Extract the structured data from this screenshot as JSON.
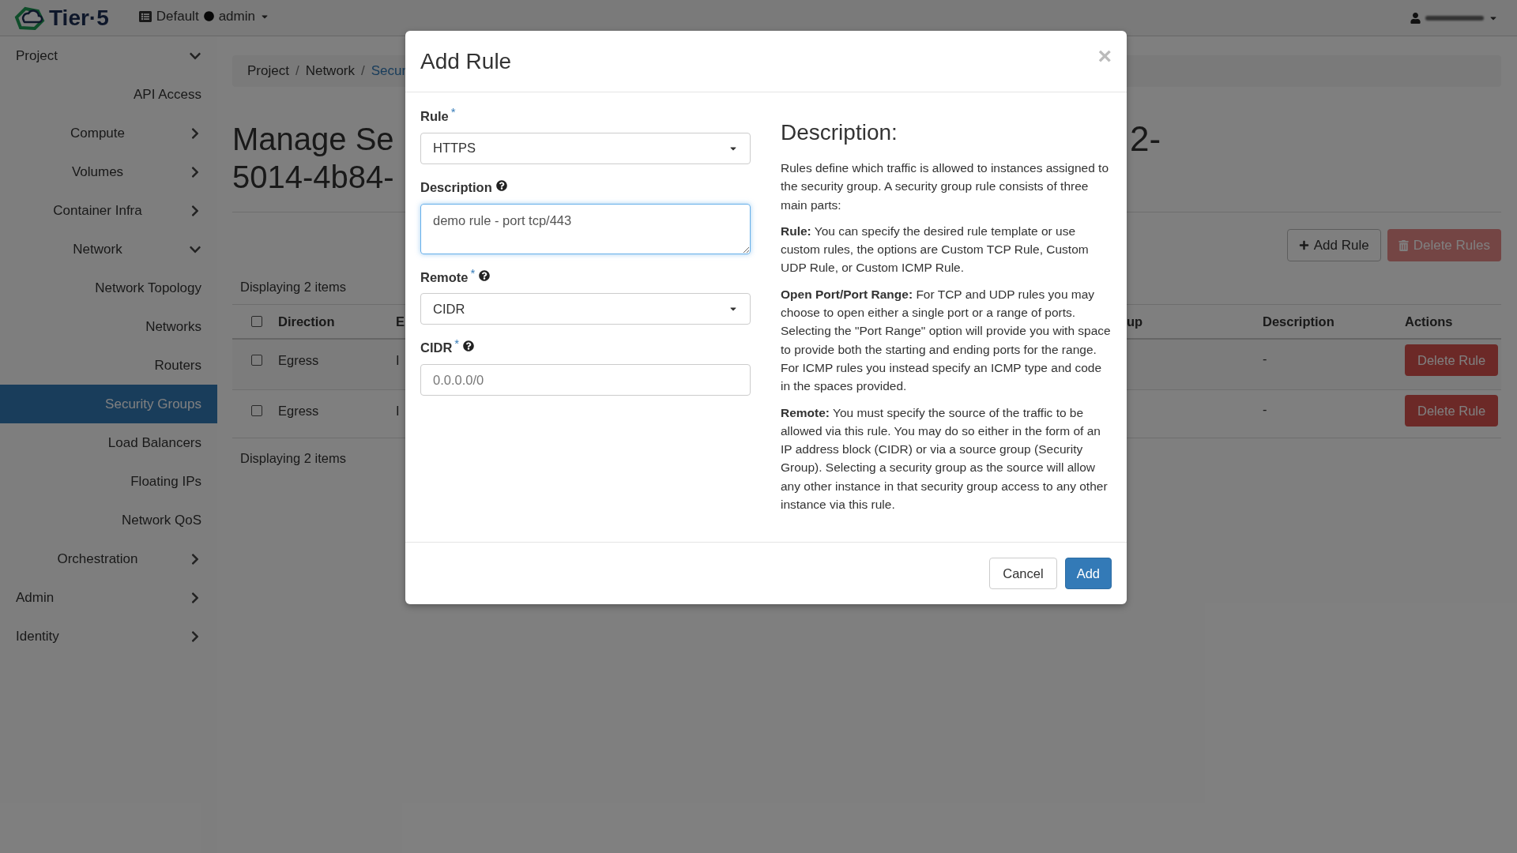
{
  "header": {
    "logo_text": "Tier·5",
    "domain": "Default",
    "project": "admin"
  },
  "sidebar": {
    "items": [
      {
        "label": "Project",
        "expanded": true,
        "children": [
          {
            "label": "API Access",
            "selected": false
          },
          {
            "label": "Compute",
            "expanded": false
          },
          {
            "label": "Volumes",
            "expanded": false
          },
          {
            "label": "Container Infra",
            "expanded": false
          },
          {
            "label": "Network",
            "expanded": true,
            "children": [
              {
                "label": "Network Topology",
                "selected": false
              },
              {
                "label": "Networks",
                "selected": false
              },
              {
                "label": "Routers",
                "selected": false
              },
              {
                "label": "Security Groups",
                "selected": true
              },
              {
                "label": "Load Balancers",
                "selected": false
              },
              {
                "label": "Floating IPs",
                "selected": false
              },
              {
                "label": "Network QoS",
                "selected": false
              }
            ]
          },
          {
            "label": "Orchestration",
            "expanded": false
          }
        ]
      },
      {
        "label": "Admin",
        "expanded": false
      },
      {
        "label": "Identity",
        "expanded": false
      }
    ]
  },
  "breadcrumb": {
    "separator": "/",
    "items": [
      "Project",
      "Network",
      "Secur"
    ]
  },
  "page": {
    "title_left": [
      "Manage Se",
      "5014-4b84-"
    ],
    "title_right": "2-",
    "add_rule": "Add Rule",
    "delete_rules": {
      "label": "Delete Rules",
      "disabled": true
    },
    "count_top": "Displaying 2 items",
    "count_bottom": "Displaying 2 items",
    "table": {
      "select_all": {
        "checked": false
      },
      "columns_left": [
        "Direction",
        "E"
      ],
      "columns_right": [
        "up",
        "Description",
        "Actions"
      ],
      "rows": [
        {
          "checked": false,
          "direction": "Egress",
          "column_3": "I",
          "description": "-",
          "action": "Delete Rule"
        },
        {
          "checked": false,
          "direction": "Egress",
          "column_3": "I",
          "description": "-",
          "action": "Delete Rule"
        }
      ]
    }
  },
  "modal": {
    "title": "Add Rule",
    "close": "×",
    "fields": [
      {
        "kind": "select",
        "label": "Rule",
        "required_mark": "*",
        "help": false,
        "focused": false,
        "value": "HTTPS"
      },
      {
        "kind": "textarea",
        "label": "Description",
        "help": true,
        "focused": true,
        "value": "demo rule - port tcp/443"
      },
      {
        "kind": "select",
        "label": "Remote",
        "required_mark": "*",
        "help": true,
        "focused": false,
        "value": "CIDR"
      },
      {
        "kind": "input",
        "label": "CIDR",
        "required_mark": "*",
        "help": true,
        "focused": false,
        "placeholder": "0.0.0.0/0"
      }
    ],
    "help_title": "Description:",
    "help_paragraphs": [
      "Rules define which traffic is allowed to instances assigned to the security group. A security group rule consists of three main parts:",
      "**Rule:** You can specify the desired rule template or use custom rules, the options are Custom TCP Rule, Custom UDP Rule, or Custom ICMP Rule.",
      "**Open Port/Port Range:** For TCP and UDP rules you may choose to open either a single port or a range of ports. Selecting the \"Port Range\" option will provide you with space to provide both the starting and ending ports for the range. For ICMP rules you instead specify an ICMP type and code in the spaces provided.",
      "**Remote:** You must specify the source of the traffic to be allowed via this rule. You may do so either in the form of an IP address block (CIDR) or via a source group (Security Group). Selecting a security group as the source will allow any other instance in that security group access to any other instance via this rule."
    ],
    "cancel": "Cancel",
    "submit": "Add"
  }
}
